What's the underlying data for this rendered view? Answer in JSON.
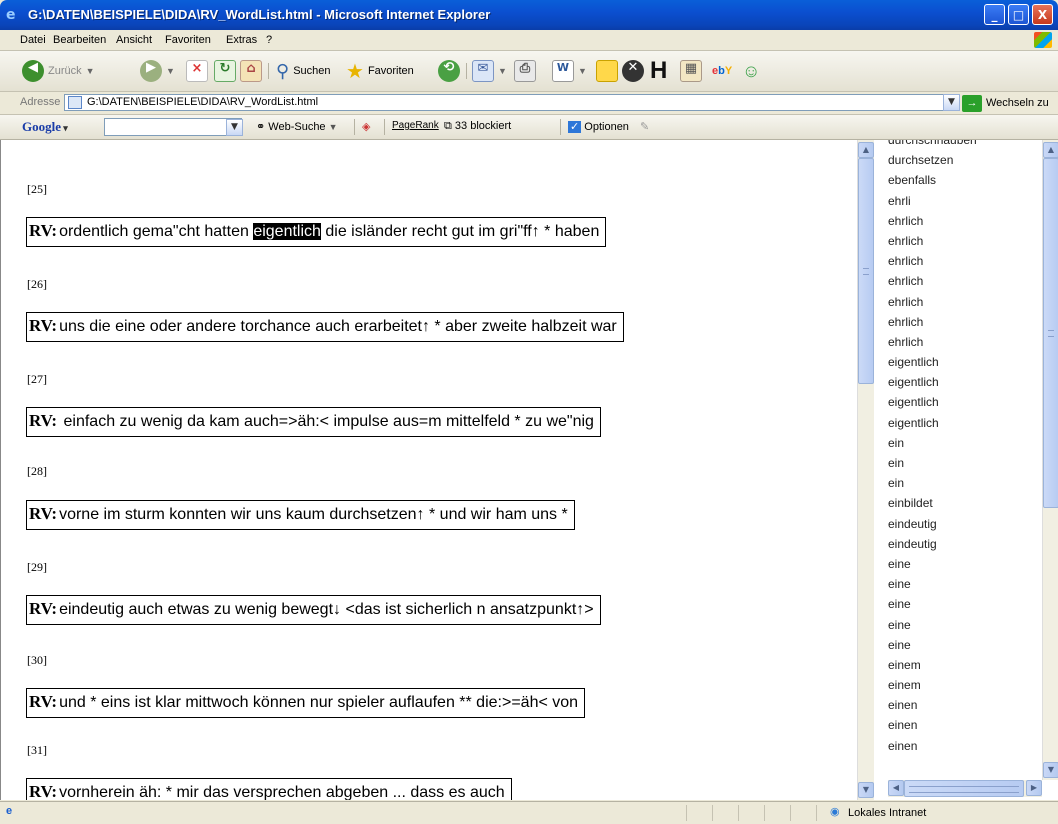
{
  "window": {
    "title": "G:\\DATEN\\BEISPIELE\\DIDA\\RV_WordList.html - Microsoft Internet Explorer",
    "minimize": "_",
    "maximize": "□",
    "close": "X"
  },
  "menu": [
    "Datei",
    "Bearbeiten",
    "Ansicht",
    "Favoriten",
    "Extras",
    "?"
  ],
  "toolbar": {
    "back": "Zurück",
    "search": "Suchen",
    "favorites": "Favoriten"
  },
  "address": {
    "label": "Adresse",
    "url": "G:\\DATEN\\BEISPIELE\\DIDA\\RV_WordList.html",
    "go": "Wechseln zu"
  },
  "google": {
    "logo": "Google",
    "search": "Web-Suche",
    "pagerank": "PageRank",
    "blocked": "33 blockiert",
    "options": "Optionen"
  },
  "transcript": [
    {
      "seg": "[25]",
      "speaker": "RV:",
      "pre": "ordentlich gema\"cht hatten ",
      "hl": "eigentlich",
      "post": " die isländer recht gut im gri\"ff↑ * haben"
    },
    {
      "seg": "[26]",
      "speaker": "RV:",
      "pre": "uns die eine oder andere torchance auch erarbeitet↑ * aber zweite halbzeit war",
      "hl": "",
      "post": ""
    },
    {
      "seg": "[27]",
      "speaker": "RV:",
      "pre": " einfach zu wenig da kam auch=>äh:< impulse aus=m mittelfeld * zu we\"nig",
      "hl": "",
      "post": ""
    },
    {
      "seg": "[28]",
      "speaker": "RV:",
      "pre": "vorne im sturm konnten wir uns kaum durchsetzen↑ * und wir ham uns *",
      "hl": "",
      "post": ""
    },
    {
      "seg": "[29]",
      "speaker": "RV:",
      "pre": "eindeutig auch etwas zu wenig bewegt↓ <das ist sicherlich n ansatzpunkt↑>",
      "hl": "",
      "post": ""
    },
    {
      "seg": "[30]",
      "speaker": "RV:",
      "pre": "und * eins ist klar mittwoch können nur spieler auflaufen ** die:>=äh< von",
      "hl": "",
      "post": ""
    },
    {
      "seg": "[31]",
      "speaker": "RV:",
      "pre": "vornherein äh: * mir das versprechen abgeben ... dass es auch",
      "hl": "",
      "post": ""
    }
  ],
  "wordlist": [
    "durchschnauben",
    "durchsetzen",
    "ebenfalls",
    "ehrli",
    "ehrlich",
    "ehrlich",
    "ehrlich",
    "ehrlich",
    "ehrlich",
    "ehrlich",
    "ehrlich",
    "eigentlich",
    "eigentlich",
    "eigentlich",
    "eigentlich",
    "ein",
    "ein",
    "ein",
    "einbildet",
    "eindeutig",
    "eindeutig",
    "eine",
    "eine",
    "eine",
    "eine",
    "eine",
    "einem",
    "einem",
    "einen",
    "einen",
    "einen"
  ],
  "status": {
    "zone": "Lokales Intranet"
  }
}
